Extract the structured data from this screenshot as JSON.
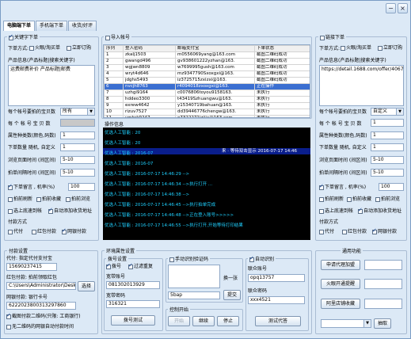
{
  "tabs": [
    "电脑端下单",
    "手机端下单",
    "收货/好评"
  ],
  "left_panel": {
    "title": "关键字下单",
    "order_mode_label": "下单方式:",
    "order_modes": [
      "火眼",
      "淘买单",
      "立即订购"
    ],
    "product_info_label": "产品信息(产品标题|搜索关键字)",
    "product_info_value": "运费邮费补价 产品标题|邮费",
    "per_account_label": "每个帐号要拍的宝贝数",
    "per_account_value": "所有",
    "per_page_label": "每 个 帐 号 宝 贝 数",
    "attr_label": "属性种类数(颜色,码数)",
    "attr_value": "1",
    "random_label": "下单数量 随机, 自定义",
    "random_value": "1",
    "browse_label": "浏览页面时间 (间区间)",
    "browse_value": "5-10",
    "shoot_label": "拍单间隔时间 (间区间)",
    "shoot_value": "5-10",
    "note_label": "下单留言 , 机率(%)",
    "note_value": "100",
    "options": [
      "拍前刷新",
      "拍前收藏",
      "拍前浏览",
      "选上底速到帐",
      "自动添加收货地址"
    ],
    "pay_label": "付款方式",
    "pay_options": [
      "代付",
      "红包付款",
      "网银付款"
    ]
  },
  "right_panel": {
    "title": "链接下单",
    "order_mode_label": "下单方式:",
    "order_modes": [
      "火眼",
      "淘买单",
      "立即订购"
    ],
    "product_info_label": "产品信息(产品标题|搜索关键字)",
    "product_info_value": "https://detail.1688.com/offer/40679",
    "per_account_label": "每个帐号要拍的宝贝数",
    "per_account_value": "自定义",
    "per_page_label": "每 个 帐 号 宝 贝 数",
    "per_page_value": "1",
    "attr_label": "属性种类数(颜色,码数)",
    "attr_value": "1",
    "random_label": "下单数量 随机, 自定义",
    "random_value": "1",
    "browse_label": "浏览页面时间 (间区间)",
    "browse_value": "5-10",
    "shoot_label": "拍单间隔时间 (间区间)",
    "shoot_value": "5-10",
    "note_label": "下单留言 , 机率(%)",
    "note_value": "100",
    "options": [
      "拍前刷新",
      "拍前收藏",
      "拍前浏览",
      "选上底速到帐",
      "自动添加收货地址"
    ],
    "pay_label": "付款方式",
    "pay_options": [
      "代付",
      "红包付款",
      "网银付款"
    ]
  },
  "accounts": {
    "title": "导入帐号",
    "headers": [
      "序列",
      "登入密码",
      "邮箱支付宝",
      "下单状态"
    ],
    "rows": [
      [
        "1",
        "zkalj1503",
        "m0556069yang@163.com",
        "截图二维码成功"
      ],
      [
        "2",
        "gwangd496",
        "gv938601222yzhan@163.",
        "截图二维码成功"
      ],
      [
        "3",
        "wgjwn8809",
        "w7699995gush@163.com",
        "截图二维码成功"
      ],
      [
        "4",
        "wryt4d646",
        "mz9347790Sxoxgxi@163.",
        "截图二维码成功"
      ],
      [
        "5",
        "jdghs5493",
        "iz3725715zxizxi@163.",
        "截图二维码成功"
      ],
      [
        "6",
        "nvcjh8763",
        "r4094018zxoxgxi@163.",
        "正在操作"
      ],
      [
        "7",
        "uzhgi9164",
        "c0076806toyou9158163.",
        "未执行"
      ],
      [
        "8",
        "hddeo3300",
        "t43419Szhuangwu@163.",
        "未执行"
      ],
      [
        "9",
        "exrew4642",
        "y15340719bahuan@163.",
        "未执行"
      ],
      [
        "10",
        "rizuv7527",
        "dd39446776chengw@163.",
        "未执行"
      ],
      [
        "11",
        "ymhrk9247",
        "o7322271izijia@163.com",
        "未执行"
      ]
    ]
  },
  "log": {
    "title": "操作信息",
    "lines": [
      "优选人工智能 : 20",
      "优选人工智能 : 20",
      "优选人工智能 : 2016-07",
      "优选人工智能 : 2016-07",
      "优选人工智能 : 2016-07-17 14:46:29 -->",
      "优选人工智能 : 2016-07-17 14:46:34 -->执行打开 ...",
      "优选人工智能 : 2016-07-17 14:46:38 -->",
      "优选人工智能 : 2016-07-17 14:46:45 -->执行拍单完成",
      "优选人工智能 : 2016-07-17 14:46:48 -->正在登入账号>>>>>",
      "优选人工智能 : 2016-07-17 14:46:55 -->执行打开,开始等待打印结果"
    ],
    "highlight": "来 · 等待双击显示 2016-07-17 14:46"
  },
  "pay_settings": {
    "title": "付款设置",
    "proxy_label": "代付: 指定代付支付宝",
    "proxy_value": "15690237415",
    "redpack_label": "红包付款: 拍前领取红包",
    "redpack_value": "C:\\Users\\Administrator\\Desk",
    "choose_button": "选择",
    "bank_label": "网银付款: 银行卡号",
    "bank_value": "6222023800313297860",
    "qr_option": "截图付款二维码(只限: 工商银行)",
    "no_qr_option": "无二维码的网银自动付款时间"
  },
  "env_settings": {
    "title": "环境属性设置",
    "dial_title": "拨号设置",
    "dial_option": "拨号",
    "filter_option": "过滤重复",
    "broadband_account_label": "宽带账号",
    "broadband_account_value": "081302013929",
    "broadband_pwd_label": "宽带密码",
    "broadband_pwd_value": "316321",
    "dial_test_button": "拨号测试",
    "captcha_option": "手动识别验证码",
    "refresh_label": "换一张",
    "captcha_value": "5bap",
    "submit_button": "提交",
    "control_title": "控制开始",
    "start_button": "开始",
    "continue_button": "继续",
    "stop_button": "停止",
    "auto_option": "自动识别",
    "account_label": "联众账号",
    "account_value": "opq13757",
    "pwd_label": "联众密码",
    "pwd_value": "xxx4521",
    "test_button": "测试代答"
  },
  "common": {
    "title": "通用功能",
    "apply_button": "申请代理加盟",
    "monitor_button": "火眼开通提醒",
    "store_button": "阿里店铺收藏",
    "extract_button": "抽取"
  }
}
